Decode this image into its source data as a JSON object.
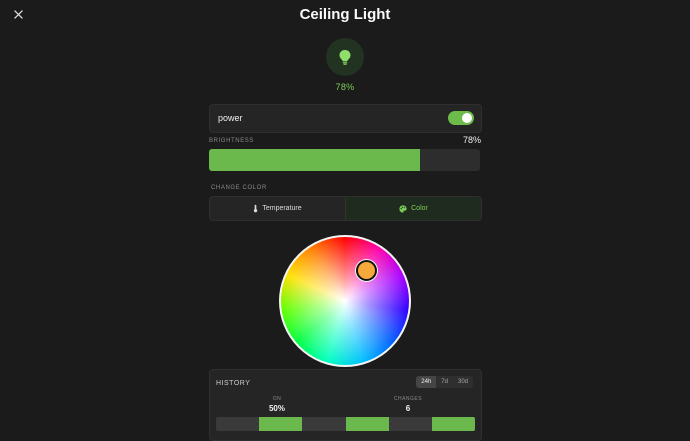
{
  "header": {
    "close_icon": "close-icon",
    "title": "Ceiling Light"
  },
  "device": {
    "icon": "lightbulb-icon",
    "level_text": "78%",
    "accent": "#6bb84d"
  },
  "power": {
    "label": "power",
    "on": true
  },
  "brightness": {
    "label": "BRIGHTNESS",
    "value_text": "78%",
    "value": 78
  },
  "color": {
    "section_label": "CHANGE COLOR",
    "tabs": [
      {
        "label": "Temperature",
        "icon": "thermometer-icon",
        "active": false
      },
      {
        "label": "Color",
        "icon": "palette-icon",
        "active": true
      }
    ],
    "selected_color": "#f5a93a"
  },
  "history": {
    "title": "HISTORY",
    "ranges": [
      {
        "label": "24h",
        "active": true
      },
      {
        "label": "7d",
        "active": false
      },
      {
        "label": "30d",
        "active": false
      }
    ],
    "stats": [
      {
        "label": "ON",
        "value": "50%"
      },
      {
        "label": "CHANGES",
        "value": "6"
      }
    ],
    "timeline": {
      "segments": [
        {
          "state": "off"
        },
        {
          "state": "on"
        },
        {
          "state": "off"
        },
        {
          "state": "on"
        },
        {
          "state": "off"
        },
        {
          "state": "on"
        }
      ]
    }
  }
}
